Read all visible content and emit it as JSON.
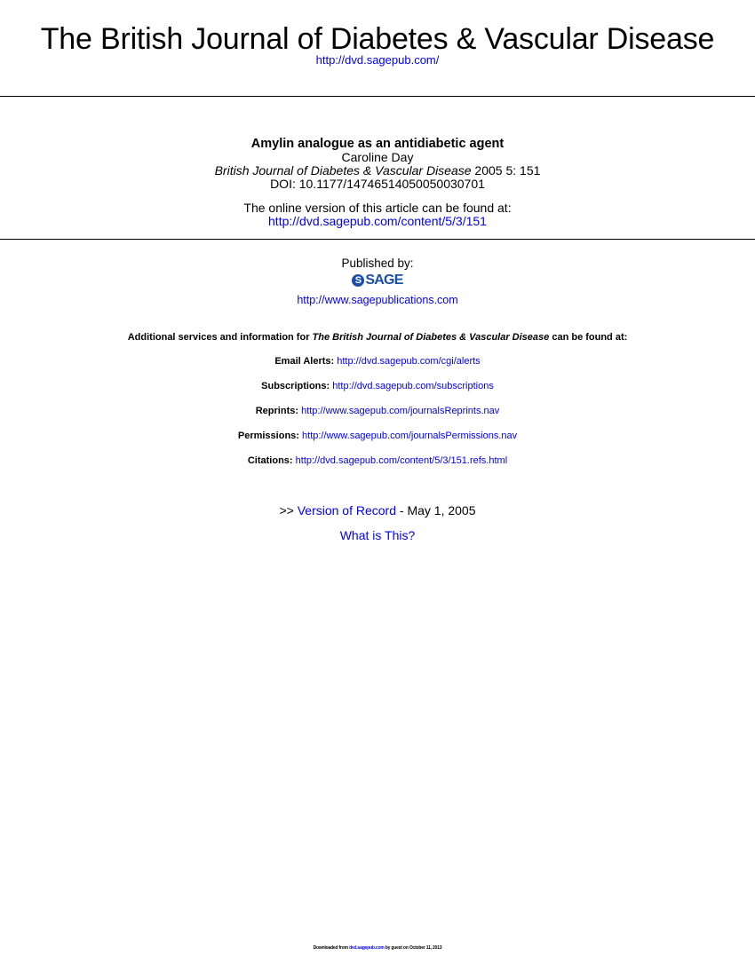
{
  "header": {
    "journal_title": "The British Journal of Diabetes & Vascular Disease",
    "journal_url": "http://dvd.sagepub.com/"
  },
  "article": {
    "title": "Amylin analogue as an antidiabetic agent",
    "author": "Caroline Day",
    "citation_journal": "British Journal of Diabetes & Vascular Disease",
    "citation_details": " 2005 5: 151",
    "doi": "DOI: 10.1177/14746514050050030701",
    "online_text": "The online version of this article can be found at:",
    "online_url": "http://dvd.sagepub.com/content/5/3/151"
  },
  "publisher": {
    "published_by": "Published by:",
    "logo_text": "SAGE",
    "logo_mark": "S",
    "url": "http://www.sagepublications.com"
  },
  "services": {
    "heading_prefix": "Additional services and information for ",
    "heading_journal": "The British Journal of Diabetes & Vascular Disease",
    "heading_suffix": " can be found at:",
    "items": [
      {
        "label": "Email Alerts:",
        "url": "http://dvd.sagepub.com/cgi/alerts"
      },
      {
        "label": "Subscriptions:",
        "url": "http://dvd.sagepub.com/subscriptions"
      },
      {
        "label": "Reprints:",
        "url": "http://www.sagepub.com/journalsReprints.nav"
      },
      {
        "label": "Permissions:",
        "url": "http://www.sagepub.com/journalsPermissions.nav"
      },
      {
        "label": "Citations:",
        "url": "http://dvd.sagepub.com/content/5/3/151.refs.html"
      }
    ]
  },
  "version": {
    "prefix": ">> ",
    "link": "Version of Record",
    "date": " - May 1, 2005",
    "what_is_this": "What is This?"
  },
  "footer": {
    "prefix": "Downloaded from ",
    "link": "dvd.sagepub.com",
    "suffix": " by guest on October 11, 2013"
  },
  "colors": {
    "link": "#0000ee",
    "sage_brand": "#1a4fa8",
    "text": "#000000"
  }
}
